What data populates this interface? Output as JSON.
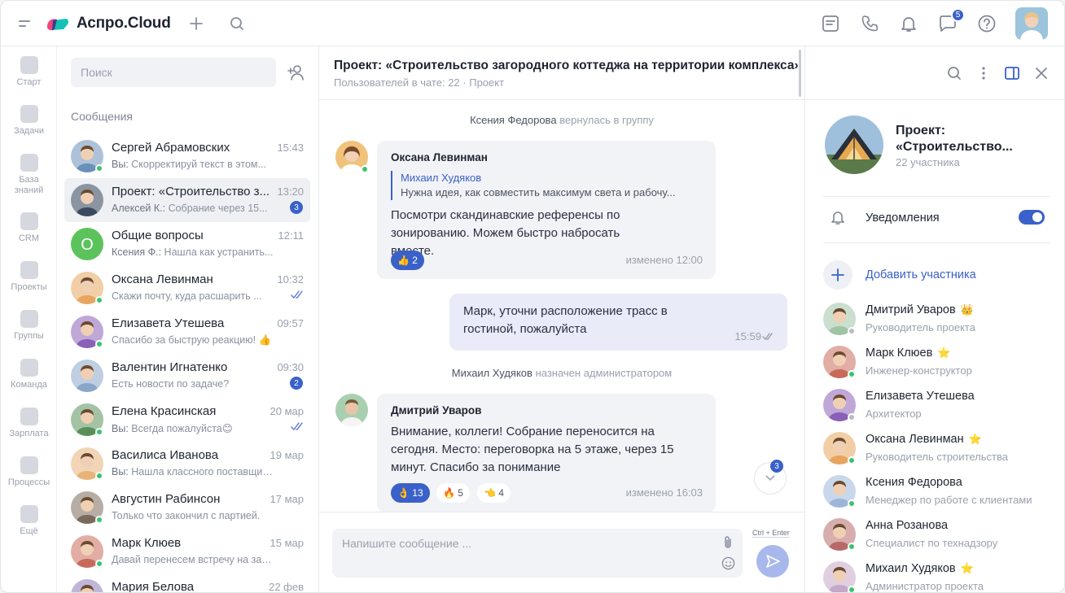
{
  "brand": {
    "name": "Аспро.Cloud"
  },
  "topbar": {
    "chat_badge": "5"
  },
  "leftnav": {
    "items": [
      {
        "label": "Старт",
        "icon": "home-icon"
      },
      {
        "label": "Задачи",
        "icon": "tasks-icon"
      },
      {
        "label": "База знаний",
        "icon": "knowledge-icon"
      },
      {
        "label": "CRM",
        "icon": "crm-icon"
      },
      {
        "label": "Проекты",
        "icon": "projects-icon"
      },
      {
        "label": "Группы",
        "icon": "groups-icon"
      },
      {
        "label": "Команда",
        "icon": "team-icon"
      },
      {
        "label": "Зарплата",
        "icon": "salary-icon"
      },
      {
        "label": "Процессы",
        "icon": "processes-icon"
      },
      {
        "label": "Ещё",
        "icon": "more-icon"
      }
    ]
  },
  "chatlist": {
    "search_placeholder": "Поиск",
    "section_title": "Сообщения",
    "items": [
      {
        "name": "Сергей Абрамовских",
        "time": "15:43",
        "who": "Вы:",
        "preview": "Скорректируй текст в этом...",
        "unread": "",
        "online": true,
        "active": false,
        "checks": false,
        "color": "#6a8fb8"
      },
      {
        "name": "Проект: «Строительство з...",
        "time": "13:20",
        "who": "Алексей К.:",
        "preview": "Собрание через 15...",
        "unread": "3",
        "online": false,
        "active": true,
        "checks": false,
        "color": "#3b4a5e"
      },
      {
        "name": "Общие вопросы",
        "time": "12:11",
        "who": "Ксения Ф.:",
        "preview": "Нашла как устранить...",
        "unread": "",
        "online": false,
        "active": false,
        "checks": false,
        "color": "#5cc35c",
        "letter": "О"
      },
      {
        "name": "Оксана Левинман",
        "time": "10:32",
        "who": "",
        "preview": "Скажи почту, куда расшарить ...",
        "unread": "",
        "online": true,
        "active": false,
        "checks": true,
        "color": "#e8a55f"
      },
      {
        "name": "Елизавета Утешева",
        "time": "09:57",
        "who": "",
        "preview": "Спасибо за быструю реакцию! 👍",
        "unread": "",
        "online": true,
        "active": false,
        "checks": false,
        "color": "#8a5fb8"
      },
      {
        "name": "Валентин Игнатенко",
        "time": "09:30",
        "who": "",
        "preview": "Есть новости по задаче?",
        "unread": "2",
        "online": false,
        "active": false,
        "checks": false,
        "color": "#8aa6c8"
      },
      {
        "name": "Елена Красинская",
        "time": "20 мар",
        "who": "Вы:",
        "preview": "Всегда пожалуйста😊",
        "unread": "",
        "online": true,
        "active": false,
        "checks": true,
        "color": "#5a8f5a"
      },
      {
        "name": "Василиса Иванова",
        "time": "19 мар",
        "who": "Вы:",
        "preview": "Нашла классного поставщика...",
        "unread": "",
        "online": true,
        "active": false,
        "checks": false,
        "color": "#e8b37a"
      },
      {
        "name": "Августин Рабинсон",
        "time": "17 мар",
        "who": "",
        "preview": "Только что закончил с партией.",
        "unread": "",
        "online": true,
        "active": false,
        "checks": false,
        "color": "#7a6a5a"
      },
      {
        "name": "Марк Клюев",
        "time": "15 мар",
        "who": "",
        "preview": "Давай перенесем встречу на завтра?",
        "unread": "",
        "online": true,
        "active": false,
        "checks": false,
        "color": "#c86a5a"
      },
      {
        "name": "Мария Белова",
        "time": "22 фев",
        "who": "",
        "preview": "",
        "unread": "",
        "online": false,
        "active": false,
        "checks": false,
        "color": "#8a7ab8"
      }
    ]
  },
  "conversation": {
    "title": "Проект: «Строительство загородного коттеджа на территории комплекса»",
    "subtitle": "Пользователей в чате: 22",
    "subtitle_type": "Проект",
    "sys1_name": "Ксения Федорова",
    "sys1_text": "вернулась в группу",
    "msg1": {
      "author": "Оксана Левинман",
      "quote_author": "Михаил Худяков",
      "quote_text": "Нужна идея, как совместить максимум света и рабочу...",
      "text": "Посмотри скандинавские референсы по зонированию. Можем быстро набросать вместе.",
      "reaction": "2",
      "meta": "изменено 12:00"
    },
    "msg2": {
      "text": "Марк, уточни расположение трасс в гостиной, пожалуйста",
      "time": "15:59"
    },
    "sys2_name": "Михаил Худяков",
    "sys2_text": "назначен администратором",
    "msg3": {
      "author": "Дмитрий Уваров",
      "text": "Внимание, коллеги! Собрание переносится на сегодня. Место: переговорка на 5 этаже, через 15 минут. Спасибо за понимание",
      "r1": "13",
      "r2": "5",
      "r3": "4",
      "meta": "изменено 16:03"
    },
    "scroll_badge": "3",
    "composer_placeholder": "Напишите сообщение ...",
    "hint": "Ctrl + Enter"
  },
  "rpanel": {
    "title": "Проект: «Строительство...",
    "count": "22 участника",
    "notifications_label": "Уведомления",
    "add_member": "Добавить участника",
    "members": [
      {
        "name": "Дмитрий Уваров",
        "role": "Руководитель проекта",
        "crown": "👑",
        "online": false,
        "color": "#9fc4a4"
      },
      {
        "name": "Марк Клюев",
        "role": "Инженер-конструктор",
        "crown": "⭐",
        "online": true,
        "color": "#c86a5a"
      },
      {
        "name": "Елизавета Утешева",
        "role": "Архитектор",
        "crown": "",
        "online": false,
        "color": "#8a5fb8"
      },
      {
        "name": "Оксана Левинман",
        "role": "Руководитель строительства",
        "crown": "⭐",
        "online": true,
        "color": "#e8a55f"
      },
      {
        "name": "Ксения Федорова",
        "role": "Менеджер по работе с клиентами",
        "crown": "",
        "online": true,
        "color": "#9cb6d8"
      },
      {
        "name": "Анна Розанова",
        "role": "Специалист по технадзору",
        "crown": "",
        "online": true,
        "color": "#b86a6a"
      },
      {
        "name": "Михаил Худяков",
        "role": "Администратор проекта",
        "crown": "⭐",
        "online": true,
        "color": "#c4a8c8"
      }
    ]
  },
  "colors": {
    "accent": "#3a61c9",
    "online": "#3cc36b"
  }
}
